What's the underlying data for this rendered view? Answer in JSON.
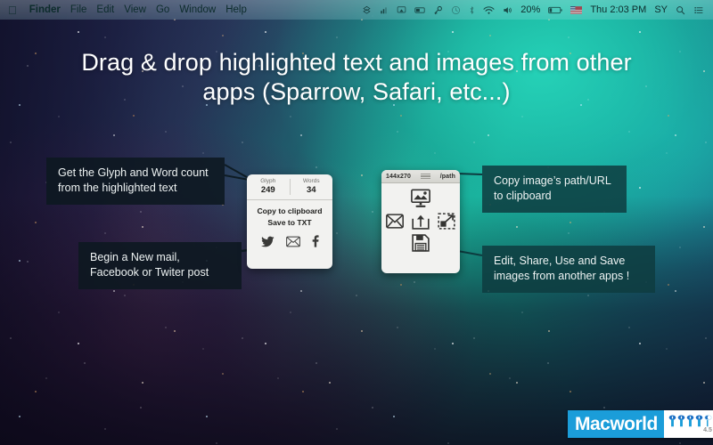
{
  "menubar": {
    "apple_icon": "apple-logo",
    "items": [
      {
        "label": "Finder",
        "bold": true
      },
      {
        "label": "File",
        "bold": false
      },
      {
        "label": "Edit",
        "bold": false
      },
      {
        "label": "View",
        "bold": false
      },
      {
        "label": "Go",
        "bold": false
      },
      {
        "label": "Window",
        "bold": false
      },
      {
        "label": "Help",
        "bold": false
      }
    ],
    "status": {
      "battery_percent": "20%",
      "clock": "Thu 2:03 PM",
      "user_initials": "SY",
      "icons": [
        "dropbox-icon",
        "bars-icon",
        "airplay-icon",
        "display-icon",
        "key-icon",
        "timemachine-icon",
        "bluetooth-icon",
        "wifi-icon",
        "volume-icon",
        "battery-icon",
        "flag-icon",
        "search-icon",
        "notification-center-icon"
      ]
    }
  },
  "headline": {
    "text": "Drag & drop highlighted text and images from other apps (Sparrow, Safari, etc...)"
  },
  "callouts": [
    {
      "id": "glyph",
      "text": "Get the Glyph and Word count\nfrom the highlighted text",
      "style": "dark"
    },
    {
      "id": "social",
      "text": "Begin a New mail,\nFacebook or Twiter post",
      "style": "dark"
    },
    {
      "id": "path",
      "text": "Copy image’s path/URL\nto clipboard",
      "style": "teal"
    },
    {
      "id": "edit",
      "text": "Edit, Share, Use and Save\nimages from another apps !",
      "style": "teal"
    }
  ],
  "text_widget": {
    "stats": [
      {
        "label": "Glyph",
        "value": "249"
      },
      {
        "label": "Words",
        "value": "34"
      }
    ],
    "actions": [
      "Copy to clipboard",
      "Save to TXT"
    ],
    "social_icons": [
      "twitter-icon",
      "mail-icon",
      "facebook-icon"
    ]
  },
  "image_widget": {
    "dimensions": "144x270",
    "path_label": "/path",
    "grip": "drag-handle-icon",
    "icons": [
      "image-to-desktop-icon",
      "mail-icon",
      "share-icon",
      "use-selection-icon",
      "save-icon"
    ]
  },
  "macworld": {
    "brand": "Macworld",
    "score_label": "4.5",
    "mice_count": 5,
    "brand_color": "#1b9dd9"
  }
}
